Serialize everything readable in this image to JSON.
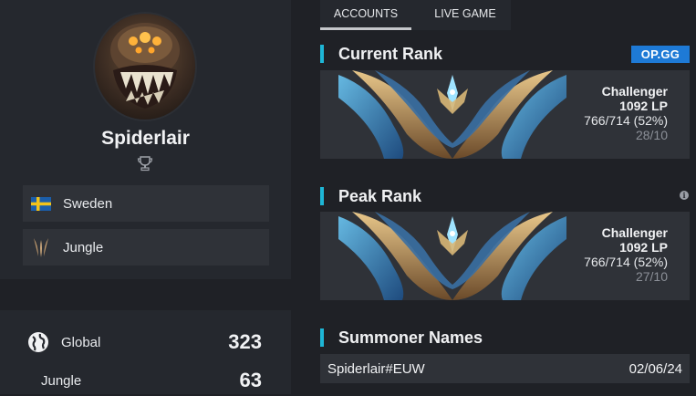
{
  "profile": {
    "summoner_name": "Spiderlair",
    "avatar_icon": "spider-champion-icon",
    "trophy_icon": "trophy-icon",
    "region": {
      "label": "Sweden",
      "icon": "sweden-flag-icon"
    },
    "role": {
      "label": "Jungle",
      "icon": "jungle-role-icon"
    }
  },
  "stats": {
    "global": {
      "label": "Global",
      "value": "323",
      "icon": "globe-icon"
    },
    "role": {
      "label": "Jungle",
      "value": "63"
    }
  },
  "tabs": [
    {
      "label": "ACCOUNTS",
      "active": true
    },
    {
      "label": "LIVE GAME",
      "active": false
    }
  ],
  "current_rank": {
    "title": "Current Rank",
    "badge": "OP.GG",
    "tier": "Challenger",
    "lp": "1092 LP",
    "winloss": "766/714 (52%)",
    "date": "28/10",
    "emblem_icon": "challenger-emblem-icon"
  },
  "peak_rank": {
    "title": "Peak Rank",
    "info_icon": "info-icon",
    "tier": "Challenger",
    "lp": "1092 LP",
    "winloss": "766/714 (52%)",
    "date": "27/10",
    "emblem_icon": "challenger-emblem-icon"
  },
  "summoner_names": {
    "title": "Summoner Names",
    "entries": [
      {
        "name": "Spiderlair#EUW",
        "date": "02/06/24"
      }
    ]
  },
  "colors": {
    "accent": "#1eb6d6",
    "opgg_badge": "#1e7ad6",
    "panel": "#25282e",
    "row": "#2f3238",
    "background": "#1f2126"
  }
}
